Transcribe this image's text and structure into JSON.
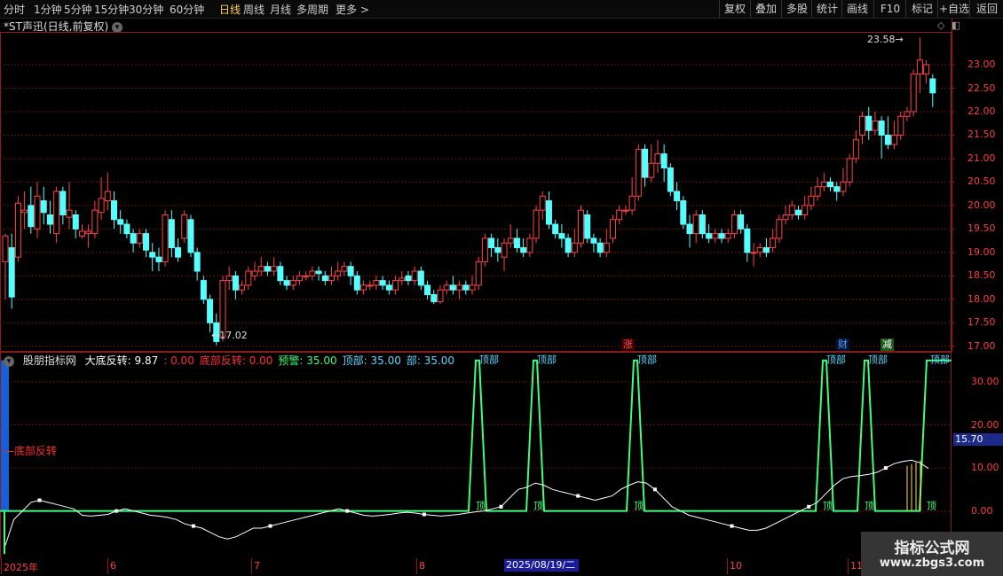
{
  "toolbar": {
    "periods": [
      "分时",
      "1分钟",
      "5分钟",
      "15分钟",
      "30分钟",
      "60分钟",
      "日线",
      "周线",
      "月线",
      "多周期",
      "更多 >"
    ],
    "active": "日线",
    "right": [
      "复权",
      "叠加",
      "多股",
      "统计",
      "画线",
      "F10",
      "标记",
      "+自选",
      "返回"
    ]
  },
  "title": "*ST声迅(日线,前复权)",
  "price_chart": {
    "y_ticks": [
      23.0,
      22.5,
      22.0,
      21.5,
      21.0,
      20.5,
      20.0,
      19.5,
      19.0,
      18.5,
      18.0,
      17.5,
      17.0
    ],
    "high_label": "23.58",
    "low_label": "17.02",
    "markers": [
      {
        "text": "涨",
        "color": "#ff5050"
      },
      {
        "text": "财",
        "color": "#5aa0ff"
      },
      {
        "text": "减",
        "color": "#ffffff"
      }
    ]
  },
  "indicator": {
    "name": "股朋指标网",
    "items": [
      {
        "label": "大底反转: 9.87",
        "color": "#ffffff"
      },
      {
        "label": ": 0.00",
        "color": "#ff3030"
      },
      {
        "label": "底部反转: 0.00",
        "color": "#ff3030"
      },
      {
        "label": "预警: 35.00",
        "color": "#3dff7a"
      },
      {
        "label": "顶部: 35.00",
        "color": "#5ad8ff"
      },
      {
        "label": "部: 35.00",
        "color": "#5ad8ff"
      }
    ],
    "y_ticks": [
      "30.00",
      "20.00",
      "10.00",
      "0.00"
    ],
    "current_value": "15.70",
    "left_label": "底部反转",
    "peak_label": "顶部",
    "bottom_label": "顶"
  },
  "dates": [
    "2025年",
    "6",
    "7",
    "8",
    "10",
    "11"
  ],
  "selected_date": "2025/08/19/二",
  "watermark": {
    "line1": "指标公式网",
    "line2": "www.zbgs3.com"
  },
  "chart_data": {
    "type": "candlestick",
    "ylim": [
      16.9,
      23.7
    ],
    "candles": [
      [
        18.8,
        19.35,
        19.4,
        18.0
      ],
      [
        19.1,
        18.05,
        19.4,
        17.8
      ],
      [
        18.9,
        20.05,
        20.2,
        18.8
      ],
      [
        19.85,
        19.9,
        20.3,
        19.5
      ],
      [
        20.0,
        19.55,
        20.4,
        19.4
      ],
      [
        19.5,
        20.2,
        20.5,
        19.3
      ],
      [
        20.1,
        19.85,
        20.4,
        19.6
      ],
      [
        19.8,
        19.6,
        20.1,
        19.4
      ],
      [
        19.4,
        20.3,
        20.4,
        19.2
      ],
      [
        20.3,
        19.8,
        20.4,
        19.6
      ],
      [
        19.75,
        19.9,
        20.5,
        19.5
      ],
      [
        19.8,
        19.5,
        19.9,
        19.3
      ],
      [
        19.35,
        19.45,
        19.6,
        19.3
      ],
      [
        19.4,
        19.45,
        19.6,
        19.1
      ],
      [
        19.4,
        19.9,
        20.1,
        19.3
      ],
      [
        19.85,
        20.15,
        20.6,
        19.7
      ],
      [
        20.1,
        20.3,
        20.7,
        19.9
      ],
      [
        20.1,
        19.7,
        20.3,
        19.5
      ],
      [
        19.7,
        19.6,
        19.9,
        19.4
      ],
      [
        19.6,
        19.4,
        19.7,
        19.3
      ],
      [
        19.4,
        19.2,
        19.5,
        19.0
      ],
      [
        19.2,
        19.4,
        19.5,
        19.1
      ],
      [
        19.4,
        19.05,
        19.5,
        18.9
      ],
      [
        19.0,
        18.9,
        19.2,
        18.6
      ],
      [
        18.9,
        18.8,
        19.1,
        18.6
      ],
      [
        18.8,
        19.8,
        19.9,
        18.7
      ],
      [
        19.7,
        19.1,
        19.9,
        18.9
      ],
      [
        19.1,
        18.9,
        19.3,
        18.8
      ],
      [
        19.3,
        19.8,
        19.9,
        19.2
      ],
      [
        19.7,
        19.0,
        19.8,
        18.9
      ],
      [
        19.0,
        18.6,
        19.1,
        18.4
      ],
      [
        18.4,
        18.0,
        18.5,
        17.9
      ],
      [
        18.0,
        17.5,
        18.1,
        17.3
      ],
      [
        17.5,
        17.1,
        17.7,
        17.02
      ],
      [
        17.2,
        18.4,
        18.5,
        17.1
      ],
      [
        18.4,
        18.5,
        18.7,
        18.2
      ],
      [
        18.5,
        18.2,
        18.6,
        18.0
      ],
      [
        18.2,
        18.3,
        18.4,
        18.1
      ],
      [
        18.3,
        18.6,
        18.7,
        18.2
      ],
      [
        18.5,
        18.6,
        18.8,
        18.4
      ],
      [
        18.6,
        18.7,
        18.9,
        18.5
      ],
      [
        18.7,
        18.6,
        18.8,
        18.5
      ],
      [
        18.6,
        18.7,
        18.9,
        18.5
      ],
      [
        18.7,
        18.4,
        18.8,
        18.3
      ],
      [
        18.4,
        18.3,
        18.5,
        18.2
      ],
      [
        18.3,
        18.4,
        18.5,
        18.2
      ],
      [
        18.4,
        18.5,
        18.6,
        18.3
      ],
      [
        18.5,
        18.5,
        18.6,
        18.4
      ],
      [
        18.5,
        18.6,
        18.7,
        18.4
      ],
      [
        18.6,
        18.55,
        18.7,
        18.4
      ],
      [
        18.5,
        18.4,
        18.6,
        18.3
      ],
      [
        18.4,
        18.5,
        18.7,
        18.3
      ],
      [
        18.5,
        18.6,
        18.8,
        18.4
      ],
      [
        18.6,
        18.7,
        18.8,
        18.5
      ],
      [
        18.7,
        18.5,
        18.8,
        18.3
      ],
      [
        18.5,
        18.2,
        18.6,
        18.1
      ],
      [
        18.2,
        18.3,
        18.4,
        18.1
      ],
      [
        18.3,
        18.3,
        18.4,
        18.2
      ],
      [
        18.3,
        18.4,
        18.5,
        18.2
      ],
      [
        18.4,
        18.3,
        18.5,
        18.2
      ],
      [
        18.3,
        18.2,
        18.4,
        18.1
      ],
      [
        18.2,
        18.4,
        18.5,
        18.1
      ],
      [
        18.4,
        18.45,
        18.6,
        18.3
      ],
      [
        18.5,
        18.4,
        18.6,
        18.3
      ],
      [
        18.4,
        18.6,
        18.7,
        18.3
      ],
      [
        18.6,
        18.3,
        18.7,
        18.2
      ],
      [
        18.3,
        18.1,
        18.4,
        18.0
      ],
      [
        18.1,
        17.95,
        18.2,
        17.9
      ],
      [
        17.95,
        18.2,
        18.3,
        17.9
      ],
      [
        18.2,
        18.3,
        18.4,
        18.1
      ],
      [
        18.3,
        18.2,
        18.5,
        18.1
      ],
      [
        18.2,
        18.3,
        18.4,
        18.0
      ],
      [
        18.3,
        18.2,
        18.4,
        18.1
      ],
      [
        18.2,
        18.3,
        18.5,
        18.1
      ],
      [
        18.3,
        18.8,
        18.9,
        18.2
      ],
      [
        18.8,
        19.3,
        19.4,
        18.7
      ],
      [
        19.3,
        19.1,
        19.4,
        18.9
      ],
      [
        19.1,
        19.0,
        19.3,
        18.8
      ],
      [
        18.9,
        19.2,
        19.3,
        18.6
      ],
      [
        19.2,
        19.3,
        19.6,
        19.1
      ],
      [
        19.3,
        19.1,
        19.5,
        19.0
      ],
      [
        19.1,
        19.0,
        19.3,
        18.9
      ],
      [
        19.0,
        19.3,
        19.4,
        18.9
      ],
      [
        19.3,
        19.9,
        20.0,
        19.2
      ],
      [
        19.9,
        20.2,
        20.3,
        19.7
      ],
      [
        20.1,
        19.6,
        20.3,
        19.5
      ],
      [
        19.6,
        19.4,
        19.7,
        19.3
      ],
      [
        19.4,
        19.3,
        19.6,
        19.1
      ],
      [
        19.3,
        19.0,
        19.4,
        18.9
      ],
      [
        19.0,
        19.2,
        19.5,
        18.9
      ],
      [
        19.2,
        19.9,
        20.0,
        19.1
      ],
      [
        19.8,
        19.3,
        19.9,
        19.2
      ],
      [
        19.3,
        19.2,
        19.4,
        19.0
      ],
      [
        19.2,
        19.0,
        19.3,
        18.9
      ],
      [
        19.0,
        19.2,
        19.5,
        18.9
      ],
      [
        19.3,
        19.7,
        19.8,
        19.2
      ],
      [
        19.7,
        19.9,
        20.0,
        19.6
      ],
      [
        19.9,
        19.9,
        20.0,
        19.8
      ],
      [
        19.9,
        20.2,
        20.6,
        19.8
      ],
      [
        20.2,
        21.2,
        21.3,
        20.1
      ],
      [
        21.2,
        20.6,
        21.3,
        20.4
      ],
      [
        20.6,
        20.9,
        21.3,
        20.5
      ],
      [
        20.9,
        21.1,
        21.4,
        20.7
      ],
      [
        21.1,
        20.8,
        21.3,
        20.5
      ],
      [
        20.8,
        20.3,
        20.9,
        20.2
      ],
      [
        20.3,
        20.1,
        20.5,
        19.9
      ],
      [
        20.1,
        19.6,
        20.2,
        19.5
      ],
      [
        19.6,
        19.4,
        19.8,
        19.1
      ],
      [
        19.4,
        19.8,
        19.9,
        19.2
      ],
      [
        19.8,
        19.4,
        19.9,
        19.3
      ],
      [
        19.4,
        19.3,
        19.6,
        19.2
      ],
      [
        19.3,
        19.4,
        19.5,
        19.2
      ],
      [
        19.4,
        19.3,
        19.5,
        19.2
      ],
      [
        19.3,
        19.4,
        19.5,
        19.2
      ],
      [
        19.4,
        19.8,
        19.9,
        19.3
      ],
      [
        19.8,
        19.5,
        19.9,
        19.4
      ],
      [
        19.5,
        19.0,
        19.6,
        18.8
      ],
      [
        19.0,
        19.0,
        19.2,
        18.7
      ],
      [
        19.0,
        19.1,
        19.2,
        18.9
      ],
      [
        19.1,
        19.0,
        19.3,
        18.9
      ],
      [
        19.1,
        19.3,
        19.5,
        19.0
      ],
      [
        19.3,
        19.7,
        19.8,
        19.2
      ],
      [
        19.7,
        19.8,
        20.0,
        19.6
      ],
      [
        19.8,
        20.0,
        20.1,
        19.7
      ],
      [
        19.9,
        19.8,
        20.0,
        19.7
      ],
      [
        19.8,
        20.0,
        20.2,
        19.7
      ],
      [
        20.0,
        20.2,
        20.4,
        19.9
      ],
      [
        20.2,
        20.4,
        20.6,
        20.1
      ],
      [
        20.4,
        20.5,
        20.7,
        20.3
      ],
      [
        20.5,
        20.4,
        20.6,
        20.3
      ],
      [
        20.4,
        20.3,
        20.5,
        20.1
      ],
      [
        20.3,
        20.5,
        20.8,
        20.2
      ],
      [
        20.5,
        21.0,
        21.1,
        20.4
      ],
      [
        21.0,
        21.4,
        21.6,
        20.9
      ],
      [
        21.5,
        21.9,
        22.0,
        21.3
      ],
      [
        21.9,
        21.6,
        22.1,
        21.4
      ],
      [
        21.6,
        21.8,
        22.0,
        21.5
      ],
      [
        21.8,
        21.5,
        21.9,
        21.0
      ],
      [
        21.5,
        21.3,
        21.9,
        21.2
      ],
      [
        21.3,
        21.5,
        21.8,
        21.2
      ],
      [
        21.5,
        21.9,
        22.0,
        21.4
      ],
      [
        21.9,
        22.0,
        22.1,
        21.8
      ],
      [
        22.0,
        22.8,
        22.9,
        21.9
      ],
      [
        22.8,
        23.1,
        23.58,
        22.4
      ],
      [
        22.8,
        23.0,
        23.1,
        22.6
      ],
      [
        22.7,
        22.4,
        22.8,
        22.1
      ]
    ],
    "indicator_line": [
      -8,
      -2,
      0,
      2,
      2.5,
      2,
      1.5,
      1,
      0.5,
      -1,
      -1.2,
      -1,
      -0.8,
      0,
      0.5,
      0,
      -0.5,
      -1,
      -1.2,
      -1.5,
      -2,
      -3,
      -3.5,
      -4,
      -5,
      -6,
      -6.5,
      -6,
      -5,
      -4,
      -4,
      -3.5,
      -3,
      -2.5,
      -2,
      -1.5,
      -1,
      -0.5,
      0,
      0.5,
      0,
      -0.5,
      -1,
      -1.2,
      -1,
      -0.8,
      -0.5,
      -0.3,
      -0.5,
      -0.8,
      -1,
      -1.2,
      -1,
      -0.8,
      -0.5,
      -0.2,
      0,
      0.5,
      1,
      3,
      5,
      5.5,
      6.5,
      6,
      5,
      4.5,
      4,
      3.5,
      3,
      2.5,
      3,
      3.5,
      5,
      6,
      6.8,
      6.5,
      5,
      3,
      1,
      0,
      -1,
      -1.5,
      -2,
      -2.5,
      -3,
      -3.5,
      -4,
      -4.5,
      -4.5,
      -4,
      -3,
      -2,
      -1,
      0,
      1,
      2,
      4,
      6,
      7.5,
      8,
      8.2,
      8.5,
      9,
      10,
      11,
      11.5,
      11.8,
      11.2,
      9.87
    ],
    "peaks": [
      108,
      121,
      144,
      188,
      198,
      213
    ],
    "n_candles": 146
  }
}
